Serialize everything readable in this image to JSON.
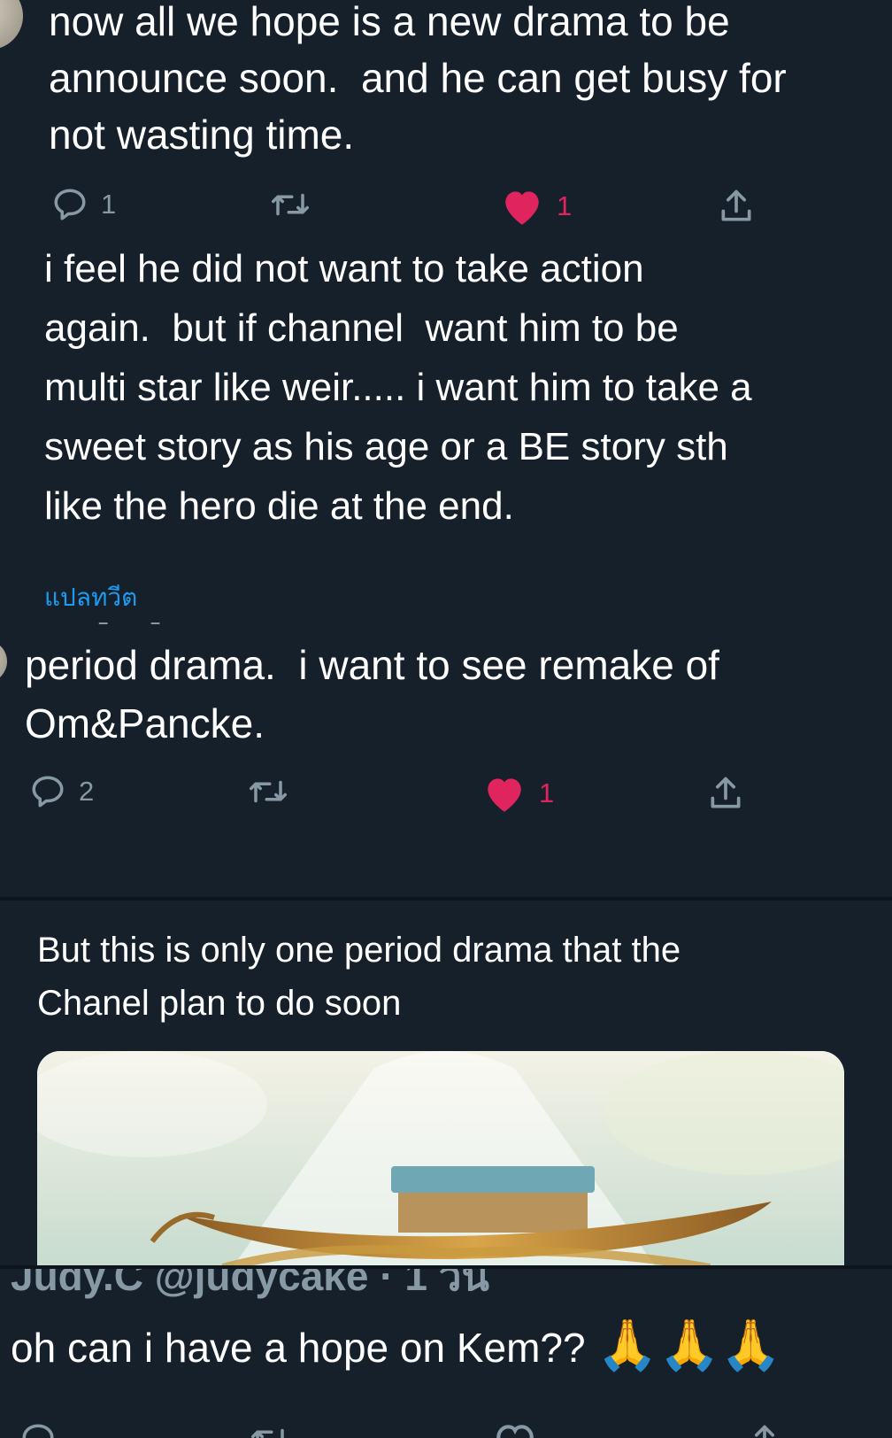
{
  "tweets": [
    {
      "text": "now all we hope is a new drama to be\nannounce soon.  and he can get busy for\nnot wasting time.",
      "replies": "1",
      "likes": "1"
    },
    {
      "text": "i feel he did not want to take action\nagain.  but if channel  want him to be\nmulti star like weir..... i want him to take a\nsweet story as his age or a BE story sth\nlike the hero die at the end.",
      "translate_label": "แปลทวีต"
    },
    {
      "text": "period drama.  i want to see remake of\nOm&Pancke.",
      "replies": "2",
      "likes": "1"
    },
    {
      "text": "But this is only one period drama that the\nChanel plan to do soon"
    },
    {
      "partial_header": "Judy.C @judycake · 1 วัน",
      "text": "oh can i have a hope on Kem?? ",
      "emoji": "🙏🙏🙏"
    }
  ],
  "colors": {
    "background": "#15202b",
    "muted": "#8899a6",
    "like": "#e0245e",
    "link": "#1d9bf0"
  },
  "icons": [
    "reply-icon",
    "retweet-icon",
    "heart-icon",
    "share-icon"
  ]
}
